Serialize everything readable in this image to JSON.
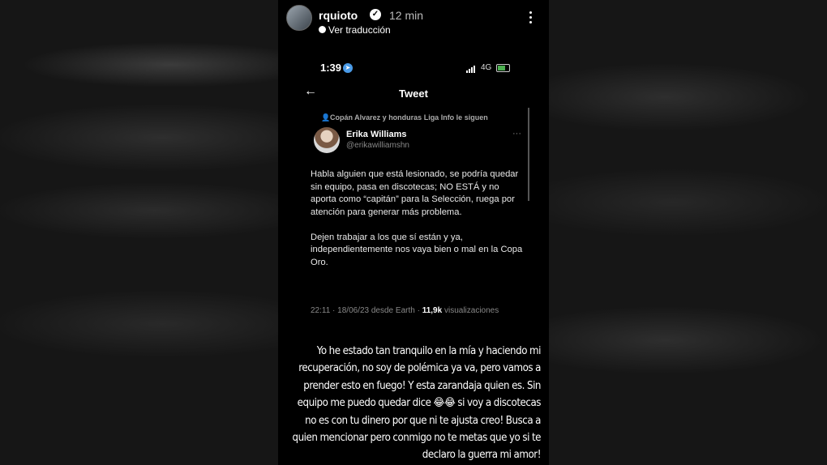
{
  "story": {
    "username": "rquioto",
    "time_ago": "12 min",
    "translate_label": "Ver traducción"
  },
  "phone_status": {
    "time": "1:39",
    "network": "4G"
  },
  "screen": {
    "title": "Tweet"
  },
  "tweet": {
    "followed_by": "Copán Alvarez y honduras Liga Info le siguen",
    "author_name": "Erika Williams",
    "author_handle": "@erikawilliamshn",
    "text": "Habla alguien que está lesionado, se podría quedar sin equipo, pasa en discotecas; NO ESTÁ y no aporta como “capitán” para la Selección, ruega por atención para generar más problema.\n\nDejen trabajar a los que sí están y ya, independientemente nos vaya bien o mal en la Copa Oro.",
    "timestamp": "22:11 · 18/06/23 desde Earth ·",
    "views_count": "11,9k",
    "views_label": "visualizaciones"
  },
  "caption": {
    "text": "Yo he estado tan tranquilo en la mía y haciendo mi recuperación, no soy de polémica ya va, pero vamos a prender esto en fuego! Y esta zarandaja quien es. Sin equipo me puedo quedar dice 😂😂 si voy a discotecas no es con tu dinero por que ni te ajusta creo! Busca a quien mencionar pero conmigo no te metas que yo si te declaro la guerra mi amor!"
  },
  "colors": {
    "background": "#000000",
    "text": "#ffffff",
    "muted": "#888888",
    "accent": "#4a9be8"
  }
}
